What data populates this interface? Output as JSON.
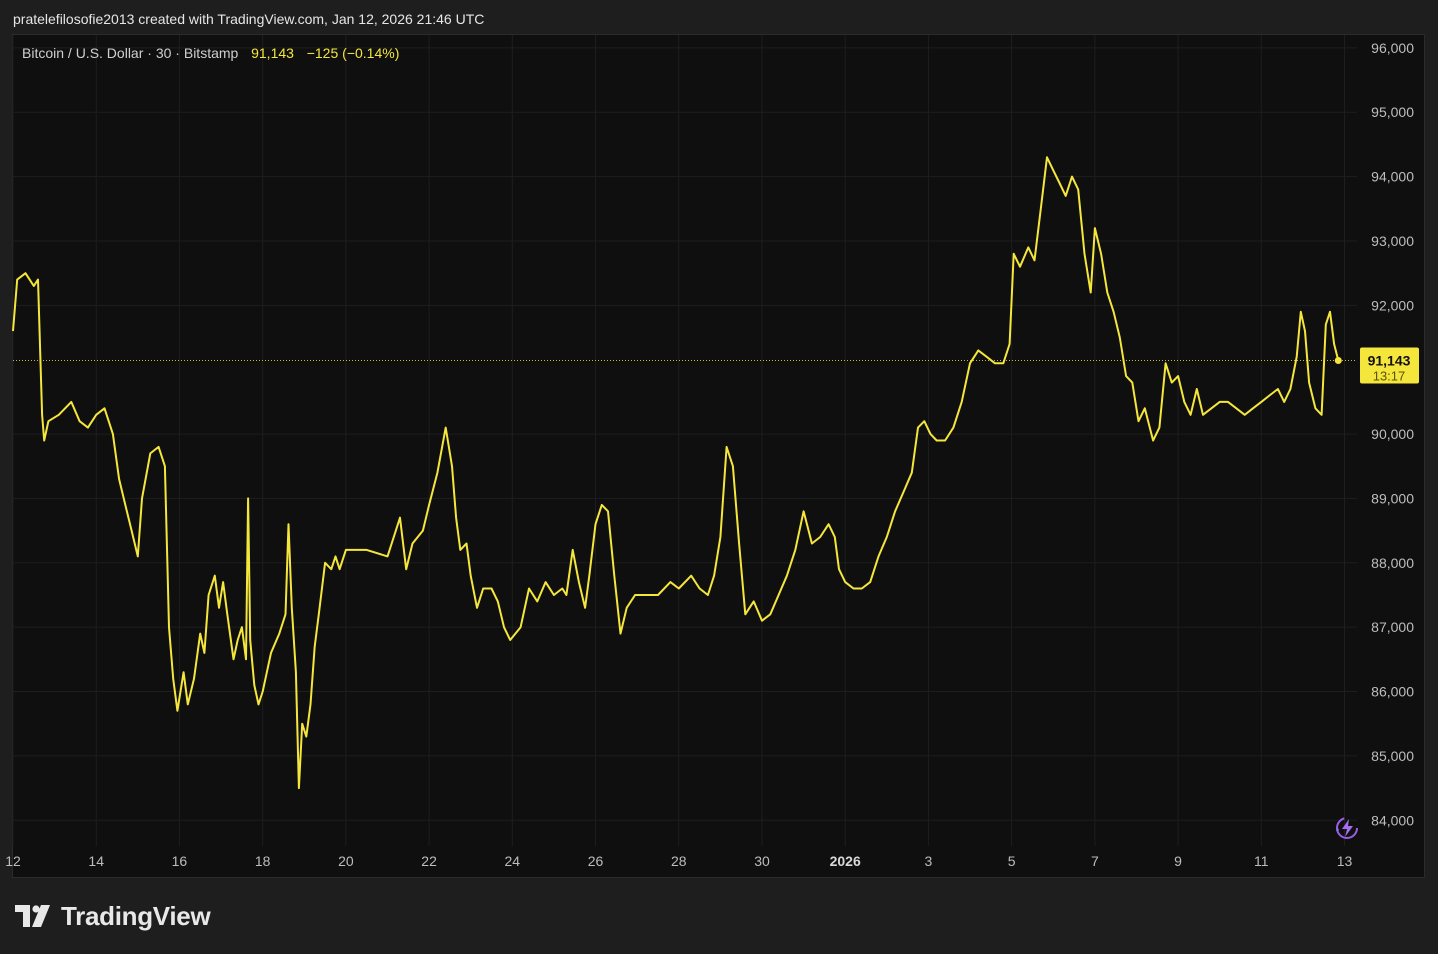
{
  "header": {
    "attribution": "pratelefilosofie2013 created with TradingView.com, Jan 12, 2026 21:46 UTC"
  },
  "symbol": {
    "name": "Bitcoin / U.S. Dollar",
    "interval": "30",
    "exchange": "Bitstamp",
    "last": "91,143",
    "change": "−125",
    "change_pct": "(−0.14%)"
  },
  "price_label": {
    "value": "91,143",
    "countdown": "13:17"
  },
  "brand": {
    "name": "TradingView"
  },
  "colors": {
    "line": "#f5e63c",
    "background": "#0f0f0f",
    "grid": "#1e1e1e",
    "axis_text": "#bdbdbd",
    "page": "#1e1e1e",
    "badge_text": "#111111"
  },
  "icons": {
    "reload": "lightning-reload-icon",
    "logo": "tradingview-logo-icon"
  },
  "chart_data": {
    "type": "line",
    "title": "",
    "xlabel": "",
    "ylabel": "",
    "ylim": [
      83600,
      96200
    ],
    "xlim": [
      12,
      13
    ],
    "x_ticks": [
      {
        "x": 12,
        "label": "12"
      },
      {
        "x": 14,
        "label": "14"
      },
      {
        "x": 16,
        "label": "16"
      },
      {
        "x": 18,
        "label": "18"
      },
      {
        "x": 20,
        "label": "20"
      },
      {
        "x": 22,
        "label": "22"
      },
      {
        "x": 24,
        "label": "24"
      },
      {
        "x": 26,
        "label": "26"
      },
      {
        "x": 28,
        "label": "28"
      },
      {
        "x": 30,
        "label": "30"
      },
      {
        "x": 32,
        "label": "2026",
        "bold": true
      },
      {
        "x": 34,
        "label": "3"
      },
      {
        "x": 36,
        "label": "5"
      },
      {
        "x": 38,
        "label": "7"
      },
      {
        "x": 40,
        "label": "9"
      },
      {
        "x": 42,
        "label": "11"
      },
      {
        "x": 44,
        "label": "13"
      }
    ],
    "y_ticks": [
      84000,
      85000,
      86000,
      87000,
      88000,
      89000,
      90000,
      92000,
      93000,
      94000,
      95000,
      96000
    ],
    "y_tick_labels": [
      "84,000",
      "85,000",
      "86,000",
      "87,000",
      "88,000",
      "89,000",
      "90,000",
      "92,000",
      "93,000",
      "94,000",
      "95,000",
      "96,000"
    ],
    "last_value": 91143,
    "series": [
      {
        "values": [
          [
            12.0,
            91600
          ],
          [
            12.1,
            92400
          ],
          [
            12.3,
            92500
          ],
          [
            12.5,
            92300
          ],
          [
            12.6,
            92400
          ],
          [
            12.7,
            90300
          ],
          [
            12.75,
            89900
          ],
          [
            12.85,
            90200
          ],
          [
            13.1,
            90300
          ],
          [
            13.4,
            90500
          ],
          [
            13.6,
            90200
          ],
          [
            13.8,
            90100
          ],
          [
            14.0,
            90300
          ],
          [
            14.2,
            90400
          ],
          [
            14.4,
            90000
          ],
          [
            14.55,
            89300
          ],
          [
            14.7,
            88900
          ],
          [
            14.85,
            88500
          ],
          [
            15.0,
            88100
          ],
          [
            15.1,
            89000
          ],
          [
            15.3,
            89700
          ],
          [
            15.5,
            89800
          ],
          [
            15.65,
            89500
          ],
          [
            15.75,
            87000
          ],
          [
            15.85,
            86200
          ],
          [
            15.95,
            85700
          ],
          [
            16.1,
            86300
          ],
          [
            16.2,
            85800
          ],
          [
            16.35,
            86200
          ],
          [
            16.5,
            86900
          ],
          [
            16.6,
            86600
          ],
          [
            16.7,
            87500
          ],
          [
            16.85,
            87800
          ],
          [
            16.95,
            87300
          ],
          [
            17.05,
            87700
          ],
          [
            17.15,
            87200
          ],
          [
            17.3,
            86500
          ],
          [
            17.4,
            86800
          ],
          [
            17.5,
            87000
          ],
          [
            17.6,
            86500
          ],
          [
            17.65,
            89000
          ],
          [
            17.7,
            86800
          ],
          [
            17.8,
            86100
          ],
          [
            17.9,
            85800
          ],
          [
            18.0,
            86000
          ],
          [
            18.2,
            86600
          ],
          [
            18.4,
            86900
          ],
          [
            18.55,
            87200
          ],
          [
            18.62,
            88600
          ],
          [
            18.7,
            87300
          ],
          [
            18.8,
            86300
          ],
          [
            18.87,
            84500
          ],
          [
            18.95,
            85500
          ],
          [
            19.05,
            85300
          ],
          [
            19.15,
            85800
          ],
          [
            19.25,
            86700
          ],
          [
            19.35,
            87200
          ],
          [
            19.5,
            88000
          ],
          [
            19.65,
            87900
          ],
          [
            19.75,
            88100
          ],
          [
            19.85,
            87900
          ],
          [
            20.0,
            88200
          ],
          [
            20.2,
            88200
          ],
          [
            20.5,
            88200
          ],
          [
            21.0,
            88100
          ],
          [
            21.3,
            88700
          ],
          [
            21.45,
            87900
          ],
          [
            21.6,
            88300
          ],
          [
            21.85,
            88500
          ],
          [
            22.0,
            88900
          ],
          [
            22.2,
            89400
          ],
          [
            22.4,
            90100
          ],
          [
            22.55,
            89500
          ],
          [
            22.65,
            88700
          ],
          [
            22.75,
            88200
          ],
          [
            22.9,
            88300
          ],
          [
            23.0,
            87800
          ],
          [
            23.15,
            87300
          ],
          [
            23.3,
            87600
          ],
          [
            23.5,
            87600
          ],
          [
            23.65,
            87400
          ],
          [
            23.8,
            87000
          ],
          [
            23.95,
            86800
          ],
          [
            24.2,
            87000
          ],
          [
            24.4,
            87600
          ],
          [
            24.6,
            87400
          ],
          [
            24.8,
            87700
          ],
          [
            25.0,
            87500
          ],
          [
            25.2,
            87600
          ],
          [
            25.3,
            87500
          ],
          [
            25.45,
            88200
          ],
          [
            25.6,
            87700
          ],
          [
            25.75,
            87300
          ],
          [
            25.85,
            87800
          ],
          [
            26.0,
            88600
          ],
          [
            26.15,
            88900
          ],
          [
            26.3,
            88800
          ],
          [
            26.45,
            87800
          ],
          [
            26.6,
            86900
          ],
          [
            26.75,
            87300
          ],
          [
            26.95,
            87500
          ],
          [
            27.2,
            87500
          ],
          [
            27.5,
            87500
          ],
          [
            27.8,
            87700
          ],
          [
            28.0,
            87600
          ],
          [
            28.3,
            87800
          ],
          [
            28.5,
            87600
          ],
          [
            28.7,
            87500
          ],
          [
            28.85,
            87800
          ],
          [
            29.0,
            88400
          ],
          [
            29.15,
            89800
          ],
          [
            29.3,
            89500
          ],
          [
            29.45,
            88300
          ],
          [
            29.6,
            87200
          ],
          [
            29.8,
            87400
          ],
          [
            30.0,
            87100
          ],
          [
            30.2,
            87200
          ],
          [
            30.4,
            87500
          ],
          [
            30.6,
            87800
          ],
          [
            30.8,
            88200
          ],
          [
            31.0,
            88800
          ],
          [
            31.2,
            88300
          ],
          [
            31.4,
            88400
          ],
          [
            31.6,
            88600
          ],
          [
            31.75,
            88400
          ],
          [
            31.85,
            87900
          ],
          [
            32.0,
            87700
          ],
          [
            32.2,
            87600
          ],
          [
            32.4,
            87600
          ],
          [
            32.6,
            87700
          ],
          [
            32.8,
            88100
          ],
          [
            33.0,
            88400
          ],
          [
            33.2,
            88800
          ],
          [
            33.4,
            89100
          ],
          [
            33.6,
            89400
          ],
          [
            33.75,
            90100
          ],
          [
            33.9,
            90200
          ],
          [
            34.05,
            90000
          ],
          [
            34.2,
            89900
          ],
          [
            34.4,
            89900
          ],
          [
            34.6,
            90100
          ],
          [
            34.8,
            90500
          ],
          [
            35.0,
            91100
          ],
          [
            35.2,
            91300
          ],
          [
            35.4,
            91200
          ],
          [
            35.6,
            91100
          ],
          [
            35.8,
            91100
          ],
          [
            35.95,
            91400
          ],
          [
            36.05,
            92800
          ],
          [
            36.2,
            92600
          ],
          [
            36.4,
            92900
          ],
          [
            36.55,
            92700
          ],
          [
            36.7,
            93500
          ],
          [
            36.85,
            94300
          ],
          [
            37.0,
            94100
          ],
          [
            37.15,
            93900
          ],
          [
            37.3,
            93700
          ],
          [
            37.45,
            94000
          ],
          [
            37.6,
            93800
          ],
          [
            37.75,
            92800
          ],
          [
            37.9,
            92200
          ],
          [
            38.0,
            93200
          ],
          [
            38.15,
            92800
          ],
          [
            38.3,
            92200
          ],
          [
            38.45,
            91900
          ],
          [
            38.6,
            91500
          ],
          [
            38.75,
            90900
          ],
          [
            38.9,
            90800
          ],
          [
            39.05,
            90200
          ],
          [
            39.2,
            90400
          ],
          [
            39.4,
            89900
          ],
          [
            39.55,
            90100
          ],
          [
            39.7,
            91100
          ],
          [
            39.85,
            90800
          ],
          [
            40.0,
            90900
          ],
          [
            40.15,
            90500
          ],
          [
            40.3,
            90300
          ],
          [
            40.45,
            90700
          ],
          [
            40.6,
            90300
          ],
          [
            40.8,
            90400
          ],
          [
            41.0,
            90500
          ],
          [
            41.2,
            90500
          ],
          [
            41.4,
            90400
          ],
          [
            41.6,
            90300
          ],
          [
            41.8,
            90400
          ],
          [
            42.0,
            90500
          ],
          [
            42.2,
            90600
          ],
          [
            42.4,
            90700
          ],
          [
            42.55,
            90500
          ],
          [
            42.7,
            90700
          ],
          [
            42.85,
            91200
          ],
          [
            42.95,
            91900
          ],
          [
            43.05,
            91600
          ],
          [
            43.15,
            90800
          ],
          [
            43.3,
            90400
          ],
          [
            43.45,
            90300
          ],
          [
            43.55,
            91700
          ],
          [
            43.65,
            91900
          ],
          [
            43.75,
            91400
          ],
          [
            43.85,
            91143
          ]
        ]
      }
    ]
  }
}
